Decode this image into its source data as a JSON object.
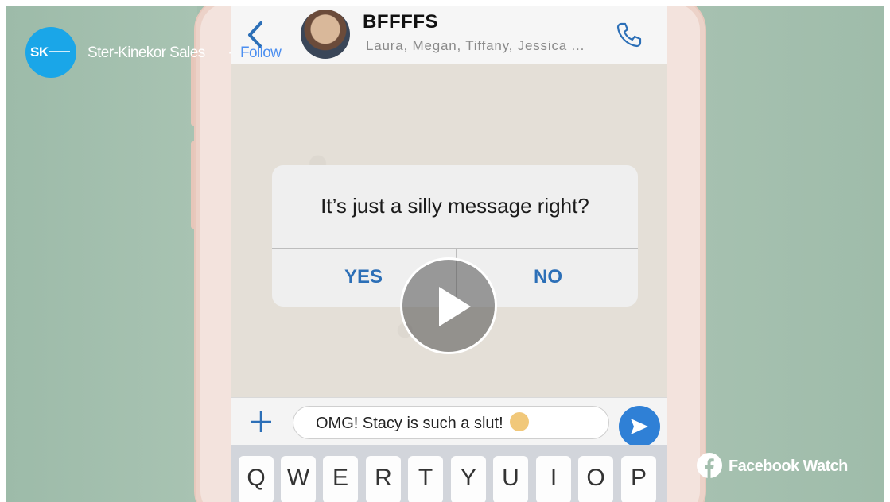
{
  "page": {
    "name": "Ster-Kinekor Sales",
    "logo_text": "SK",
    "separator": "·",
    "follow_label": "Follow"
  },
  "video": {
    "chat": {
      "group_name": "BFFFFS",
      "members": "Laura, Megan, Tiffany, Jessica ..."
    },
    "dialog": {
      "message": "It’s just a silly message right?",
      "yes_label": "YES",
      "no_label": "NO"
    },
    "input": {
      "text": "OMG! Stacy is such a slut!"
    },
    "keyboard": {
      "keys": [
        "Q",
        "W",
        "E",
        "R",
        "T",
        "Y",
        "U",
        "I",
        "O",
        "P"
      ]
    }
  },
  "footer": {
    "watch_label": "Facebook Watch"
  },
  "colors": {
    "background": "#a3bfae",
    "brand_blue": "#1aa6e8",
    "link_blue": "#4c8ff0",
    "dialog_button": "#2c6fb7",
    "send_button": "#2f80d6"
  },
  "icons": [
    "back-icon",
    "call-icon",
    "plus-icon",
    "send-icon",
    "play-icon",
    "facebook-icon",
    "emoji-icon"
  ]
}
